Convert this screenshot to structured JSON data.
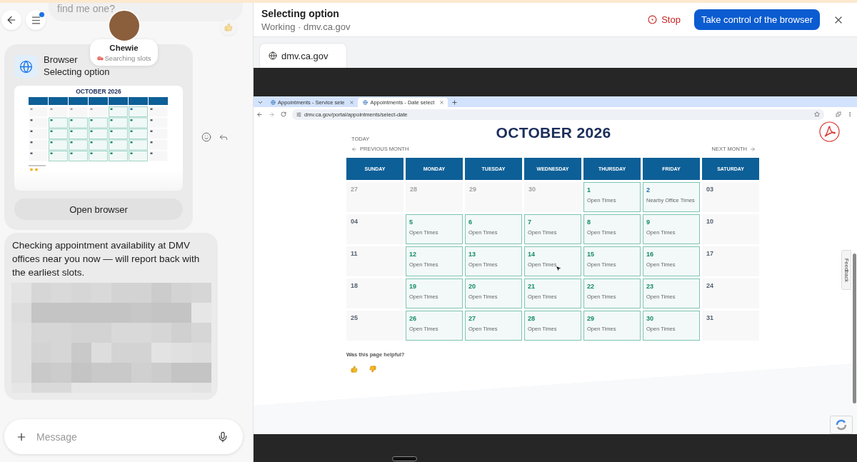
{
  "chat": {
    "previous_message": "find me one?",
    "menu_unread": true,
    "agent": {
      "name": "Chewie",
      "status": "Searching slots"
    },
    "tool_card": {
      "tool": "Browser",
      "status": "Selecting option",
      "preview_title": "OCTOBER 2026",
      "button": "Open browser"
    },
    "reply": "Checking appointment availability at DMV offices near you now — will report back with the earliest slots.",
    "composer": {
      "placeholder": "Message"
    }
  },
  "browser_panel": {
    "title": "Selecting option",
    "subtitle": "Working · dmv.ca.gov",
    "stop": "Stop",
    "take_control": "Take control of the browser",
    "tabs": [
      {
        "label": "dmv.ca.gov",
        "selected": true
      }
    ],
    "screen": {
      "tabs": [
        {
          "label": "Appointments - Service sele",
          "selected": false
        },
        {
          "label": "Appointments - Date select",
          "selected": true
        }
      ],
      "url": "dmv.ca.gov/portal/appointments/select-date",
      "calendar": {
        "title": "OCTOBER 2026",
        "today": "TODAY",
        "previous": "PREVIOUS MONTH",
        "next": "NEXT MONTH",
        "weekdays": [
          "SUNDAY",
          "MONDAY",
          "TUESDAY",
          "WEDNESDAY",
          "THURSDAY",
          "FRIDAY",
          "SATURDAY"
        ],
        "weeks": [
          [
            {
              "day": "27",
              "kind": "outside"
            },
            {
              "day": "28",
              "kind": "outside"
            },
            {
              "day": "29",
              "kind": "outside"
            },
            {
              "day": "30",
              "kind": "outside"
            },
            {
              "day": "1",
              "kind": "open",
              "note": "Open Times"
            },
            {
              "day": "2",
              "kind": "nearby",
              "note": "Nearby Office Times"
            },
            {
              "day": "03",
              "kind": "weekend"
            }
          ],
          [
            {
              "day": "04",
              "kind": "weekend"
            },
            {
              "day": "5",
              "kind": "open",
              "note": "Open Times"
            },
            {
              "day": "6",
              "kind": "open",
              "note": "Open Times"
            },
            {
              "day": "7",
              "kind": "open",
              "note": "Open Times"
            },
            {
              "day": "8",
              "kind": "open",
              "note": "Open Times"
            },
            {
              "day": "9",
              "kind": "open",
              "note": "Open Times"
            },
            {
              "day": "10",
              "kind": "weekend"
            }
          ],
          [
            {
              "day": "11",
              "kind": "weekend"
            },
            {
              "day": "12",
              "kind": "open",
              "note": "Open Times"
            },
            {
              "day": "13",
              "kind": "open",
              "note": "Open Times"
            },
            {
              "day": "14",
              "kind": "open",
              "note": "Open Times"
            },
            {
              "day": "15",
              "kind": "open",
              "note": "Open Times"
            },
            {
              "day": "16",
              "kind": "open",
              "note": "Open Times"
            },
            {
              "day": "17",
              "kind": "weekend"
            }
          ],
          [
            {
              "day": "18",
              "kind": "weekend"
            },
            {
              "day": "19",
              "kind": "open",
              "note": "Open Times"
            },
            {
              "day": "20",
              "kind": "open",
              "note": "Open Times"
            },
            {
              "day": "21",
              "kind": "open",
              "note": "Open Times"
            },
            {
              "day": "22",
              "kind": "open",
              "note": "Open Times"
            },
            {
              "day": "23",
              "kind": "open",
              "note": "Open Times"
            },
            {
              "day": "24",
              "kind": "weekend"
            }
          ],
          [
            {
              "day": "25",
              "kind": "weekend"
            },
            {
              "day": "26",
              "kind": "open",
              "note": "Open Times"
            },
            {
              "day": "27",
              "kind": "open",
              "note": "Open Times"
            },
            {
              "day": "28",
              "kind": "open",
              "note": "Open Times"
            },
            {
              "day": "29",
              "kind": "open",
              "note": "Open Times"
            },
            {
              "day": "30",
              "kind": "open",
              "note": "Open Times"
            },
            {
              "day": "31",
              "kind": "weekend"
            }
          ]
        ]
      },
      "helpful_prompt": "Was this page helpful?",
      "feedback_tab": "Feedback"
    }
  }
}
